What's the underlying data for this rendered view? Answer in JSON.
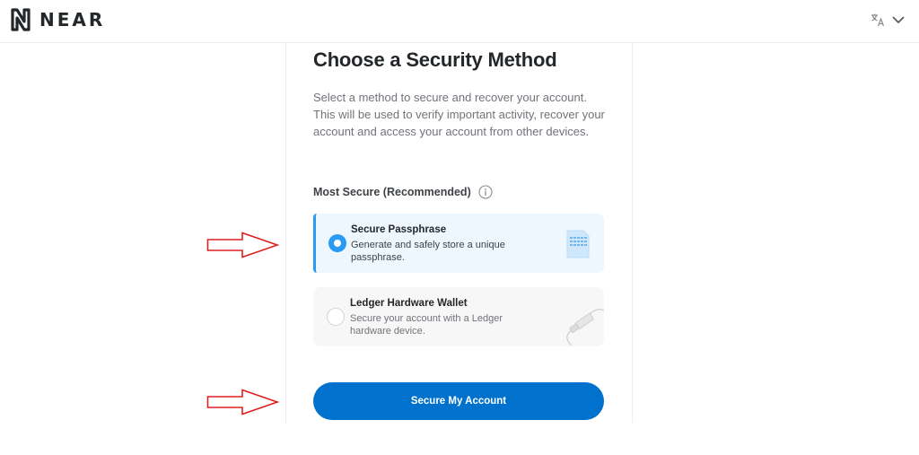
{
  "header": {
    "logo_text": "NEAR",
    "language_icon": "translate-icon",
    "dropdown_icon": "chevron-down-icon"
  },
  "main": {
    "title": "Choose a Security Method",
    "description": "Select a method to secure and recover your account. This will be used to verify important activity, recover your account and access your account from other devices.",
    "section_label": "Most Secure (Recommended)",
    "info_icon": "info-icon",
    "options": [
      {
        "title": "Secure Passphrase",
        "description": "Generate and safely store a unique passphrase.",
        "selected": true,
        "icon": "passphrase-document-icon"
      },
      {
        "title": "Ledger Hardware Wallet",
        "description": "Secure your account with a Ledger hardware device.",
        "selected": false,
        "icon": "ledger-device-icon"
      }
    ],
    "cta_label": "Secure My Account"
  },
  "annotations": {
    "arrow_icon": "red-outline-arrow-icon",
    "arrow_color": "#e02020"
  },
  "colors": {
    "accent": "#0072ce",
    "selected_accent": "#2b9af3",
    "selected_bg": "#eef7fe"
  }
}
